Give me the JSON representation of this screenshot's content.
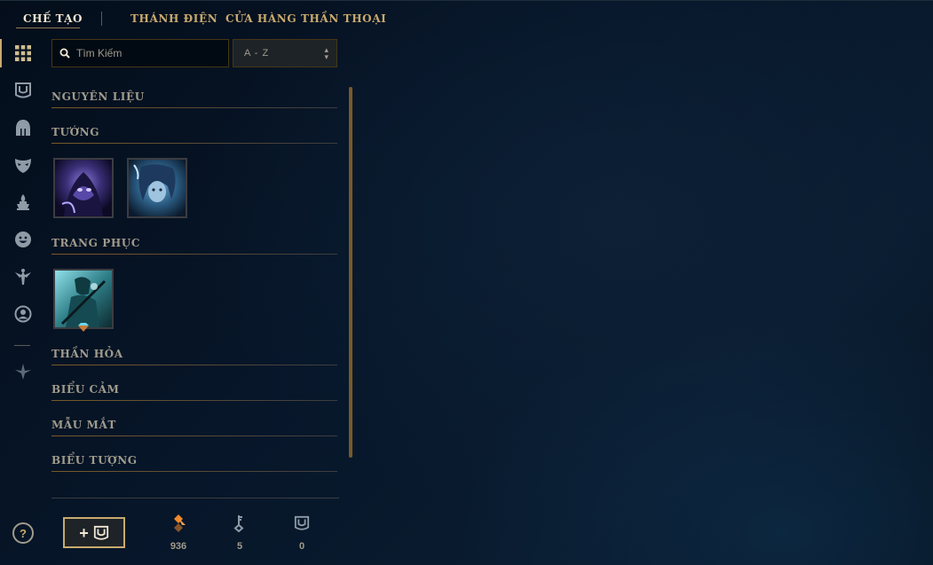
{
  "nav": {
    "tabs": [
      {
        "label": "CHẾ TẠO",
        "active": true
      },
      {
        "label": "THÁNH ĐIỆN",
        "active": false
      },
      {
        "label": "CỬA HÀNG THẦN THOẠI",
        "active": false
      }
    ]
  },
  "sidebar": {
    "icons": [
      "grid-icon",
      "chest-icon",
      "helmet-icon",
      "mask-icon",
      "ward-icon",
      "emote-icon",
      "emblem-icon",
      "profile-icon",
      "tft-icon"
    ],
    "help_label": "?"
  },
  "search": {
    "placeholder": "Tìm Kiếm",
    "value": ""
  },
  "sort": {
    "value": "A - Z"
  },
  "categories": [
    {
      "label": "NGUYÊN LIỆU"
    },
    {
      "label": "TƯỚNG"
    },
    {
      "label": "TRANG PHỤC"
    },
    {
      "label": "THẦN HỎA"
    },
    {
      "label": "BIỂU CẢM"
    },
    {
      "label": "MẪU MẮT"
    },
    {
      "label": "BIỂU TƯỢNG"
    }
  ],
  "champion_items": [
    "champion-portrait-1",
    "champion-portrait-2"
  ],
  "skin_items": [
    "skin-portrait-1"
  ],
  "colors": {
    "gold": "#c8aa6e",
    "gold_dark": "#785a28",
    "text": "#a09b8c",
    "bg": "#010a13",
    "orange_essence": "#f0882a"
  },
  "bottom": {
    "add_button_label": "+",
    "currencies": [
      {
        "name": "orange-essence-icon",
        "value": "936"
      },
      {
        "name": "key-icon",
        "value": "5"
      },
      {
        "name": "chest-icon",
        "value": "0"
      }
    ]
  }
}
